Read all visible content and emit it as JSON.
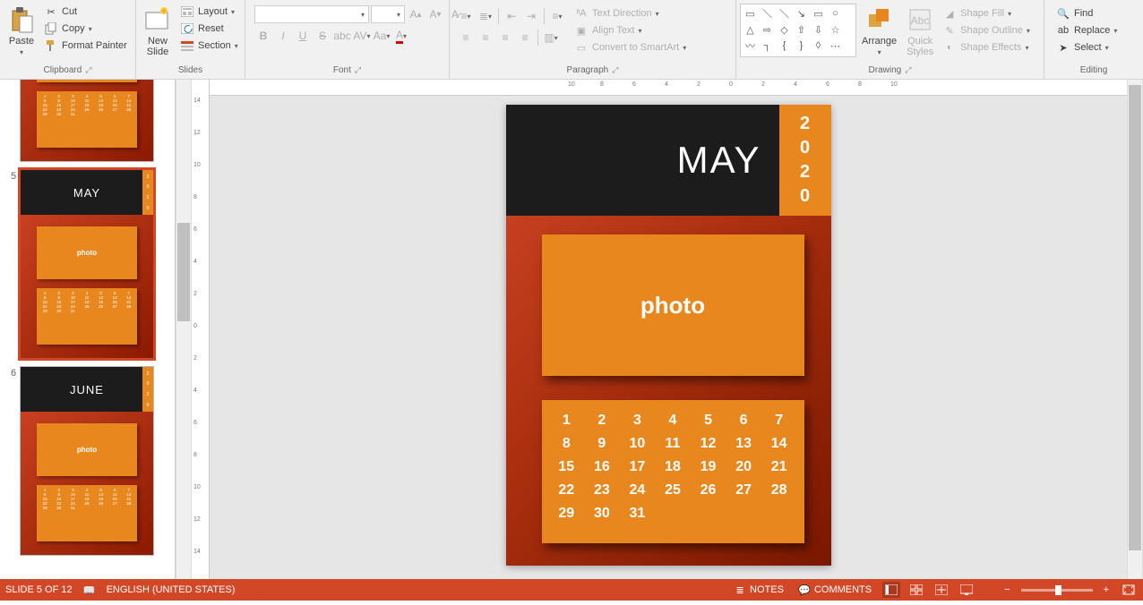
{
  "ribbon": {
    "clipboard": {
      "label": "Clipboard",
      "paste": "Paste",
      "cut": "Cut",
      "copy": "Copy",
      "format_painter": "Format Painter"
    },
    "slides": {
      "label": "Slides",
      "new_slide": "New\nSlide",
      "layout": "Layout",
      "reset": "Reset",
      "section": "Section"
    },
    "font": {
      "label": "Font"
    },
    "paragraph": {
      "label": "Paragraph",
      "text_direction": "Text Direction",
      "align_text": "Align Text",
      "convert_smartart": "Convert to SmartArt"
    },
    "drawing": {
      "label": "Drawing",
      "arrange": "Arrange",
      "quick_styles": "Quick\nStyles",
      "shape_fill": "Shape Fill",
      "shape_outline": "Shape Outline",
      "shape_effects": "Shape Effects"
    },
    "editing": {
      "label": "Editing",
      "find": "Find",
      "replace": "Replace",
      "select": "Select"
    }
  },
  "thumbs": {
    "visible": [
      {
        "num": "",
        "month": "",
        "partial_top": true
      },
      {
        "num": "5",
        "month": "MAY",
        "selected": true
      },
      {
        "num": "6",
        "month": "JUNE",
        "partial_bottom": true
      }
    ],
    "year_digits": [
      "2",
      "0",
      "2",
      "0"
    ],
    "photo_label": "photo",
    "cal_rows": [
      [
        "1",
        "2",
        "3",
        "4",
        "5",
        "6",
        "7"
      ],
      [
        "8",
        "9",
        "10",
        "11",
        "12",
        "13",
        "14"
      ],
      [
        "15",
        "16",
        "17",
        "18",
        "19",
        "20",
        "21"
      ],
      [
        "22",
        "23",
        "24",
        "25",
        "26",
        "27",
        "28"
      ],
      [
        "29",
        "30",
        "31",
        "",
        "",
        "",
        ""
      ]
    ]
  },
  "slide": {
    "month": "MAY",
    "year_digits": [
      "2",
      "0",
      "2",
      "0"
    ],
    "photo_label": "photo",
    "cal": [
      [
        "1",
        "2",
        "3",
        "4",
        "5",
        "6",
        "7"
      ],
      [
        "8",
        "9",
        "10",
        "11",
        "12",
        "13",
        "14"
      ],
      [
        "15",
        "16",
        "17",
        "18",
        "19",
        "20",
        "21"
      ],
      [
        "22",
        "23",
        "24",
        "25",
        "26",
        "27",
        "28"
      ],
      [
        "29",
        "30",
        "31",
        "",
        "",
        "",
        ""
      ]
    ]
  },
  "ruler": {
    "v": [
      "14",
      "12",
      "10",
      "8",
      "6",
      "4",
      "2",
      "0",
      "2",
      "4",
      "6",
      "8",
      "10",
      "12",
      "14"
    ],
    "h": [
      "10",
      "8",
      "6",
      "4",
      "2",
      "0",
      "2",
      "4",
      "6",
      "8",
      "10"
    ]
  },
  "status": {
    "slide_info": "SLIDE 5 OF 12",
    "language": "ENGLISH (UNITED STATES)",
    "notes": "NOTES",
    "comments": "COMMENTS"
  }
}
